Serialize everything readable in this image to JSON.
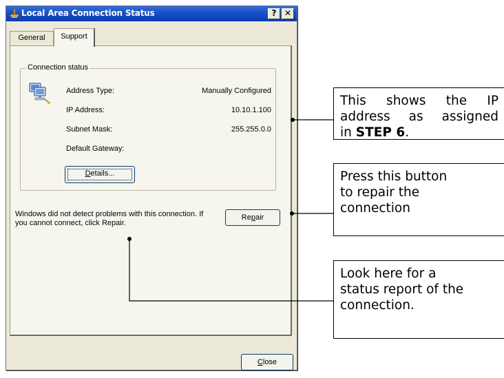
{
  "window": {
    "title": "Local Area Connection Status",
    "help_label": "?",
    "close_label": "✕"
  },
  "tabs": [
    {
      "label": "General"
    },
    {
      "label": "Support"
    }
  ],
  "connection_status": {
    "group_label": "Connection status",
    "rows": [
      {
        "label": "Address Type:",
        "value": "Manually Configured"
      },
      {
        "label": "IP Address:",
        "value": "10.10.1.100"
      },
      {
        "label": "Subnet Mask:",
        "value": "255.255.0.0"
      },
      {
        "label": "Default Gateway:",
        "value": ""
      }
    ],
    "details_button": {
      "pre": "",
      "accel": "D",
      "post": "etails..."
    }
  },
  "message": "Windows did not detect problems with this connection. If you cannot connect, click Repair.",
  "repair_button": {
    "pre": "Re",
    "accel": "p",
    "post": "air"
  },
  "close_button": {
    "pre": "",
    "accel": "C",
    "post": "lose"
  },
  "callouts": {
    "ip": {
      "line1": "This shows the IP",
      "line2": "address as assigned",
      "line3_pre": "in ",
      "line3_bold": "STEP 6",
      "line3_post": "."
    },
    "repair": {
      "line1": "Press this button",
      "line2": "to repair the",
      "line3": "connection"
    },
    "status": {
      "line1": "Look here for a",
      "line2": "status report of the",
      "line3": "connection."
    }
  },
  "icons": {
    "title": "network-connection-icon",
    "group": "network-connection-icon"
  }
}
